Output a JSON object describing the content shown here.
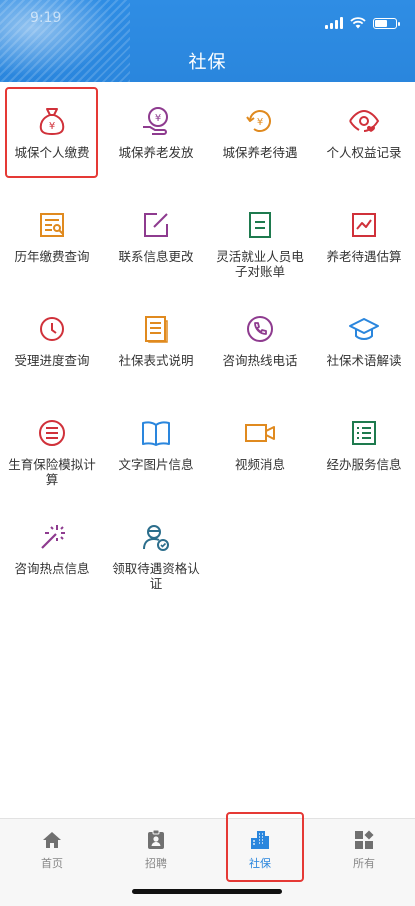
{
  "status": {
    "time": "9:19"
  },
  "header": {
    "title": "社保"
  },
  "menu": [
    {
      "label": "城保个人缴费",
      "icon": "money-bag-icon"
    },
    {
      "label": "城保养老发放",
      "icon": "pension-issue-icon"
    },
    {
      "label": "城保养老待遇",
      "icon": "pension-benefit-icon"
    },
    {
      "label": "个人权益记录",
      "icon": "eye-heart-icon"
    },
    {
      "label": "历年缴费查询",
      "icon": "payment-history-icon"
    },
    {
      "label": "联系信息更改",
      "icon": "edit-icon"
    },
    {
      "label": "灵活就业人员电子对账单",
      "icon": "statement-icon"
    },
    {
      "label": "养老待遇估算",
      "icon": "chart-estimate-icon"
    },
    {
      "label": "受理进度查询",
      "icon": "clock-icon"
    },
    {
      "label": "社保表式说明",
      "icon": "document-icon"
    },
    {
      "label": "咨询热线电话",
      "icon": "phone-icon"
    },
    {
      "label": "社保术语解读",
      "icon": "graduation-cap-icon"
    },
    {
      "label": "生育保险模拟计算",
      "icon": "list-circle-icon"
    },
    {
      "label": "文字图片信息",
      "icon": "book-icon"
    },
    {
      "label": "视频消息",
      "icon": "video-icon"
    },
    {
      "label": "经办服务信息",
      "icon": "checklist-icon"
    },
    {
      "label": "咨询热点信息",
      "icon": "magic-wand-icon"
    },
    {
      "label": "领取待遇资格认证",
      "icon": "user-verify-icon"
    }
  ],
  "tabs": [
    {
      "label": "首页",
      "icon": "home-icon"
    },
    {
      "label": "招聘",
      "icon": "badge-icon"
    },
    {
      "label": "社保",
      "icon": "building-icon"
    },
    {
      "label": "所有",
      "icon": "apps-icon"
    }
  ],
  "colors": {
    "header": "#2a86dd",
    "active_tab": "#2a86dd",
    "highlight": "#e53935"
  }
}
